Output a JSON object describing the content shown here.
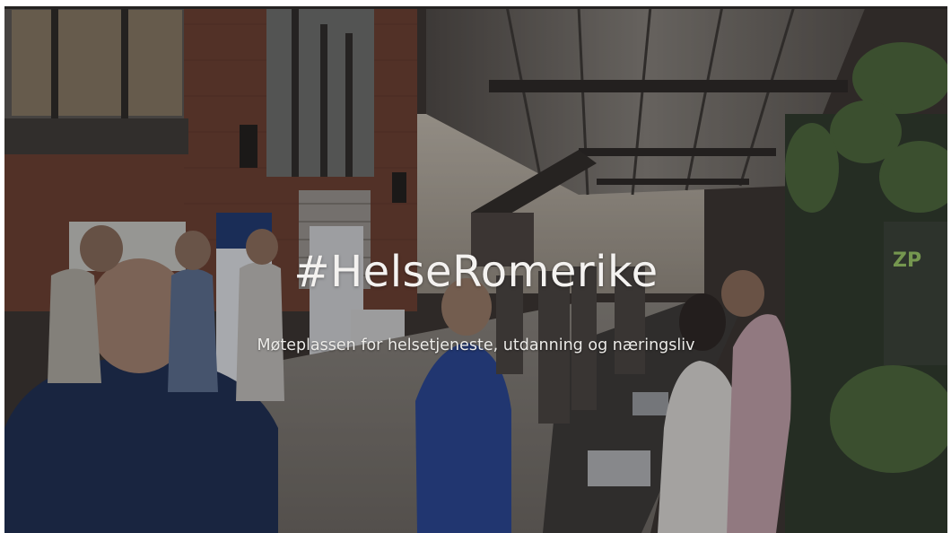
{
  "hero": {
    "title": "#HelseRomerike",
    "subtitle": "Møteplassen for helsetjeneste, utdanning og næringsliv"
  },
  "photo": {
    "subject": "exhibition hall with people",
    "overlay_color": "#141212"
  },
  "colors": {
    "text": "#f4f2f0",
    "page_background": "#ffffff"
  }
}
